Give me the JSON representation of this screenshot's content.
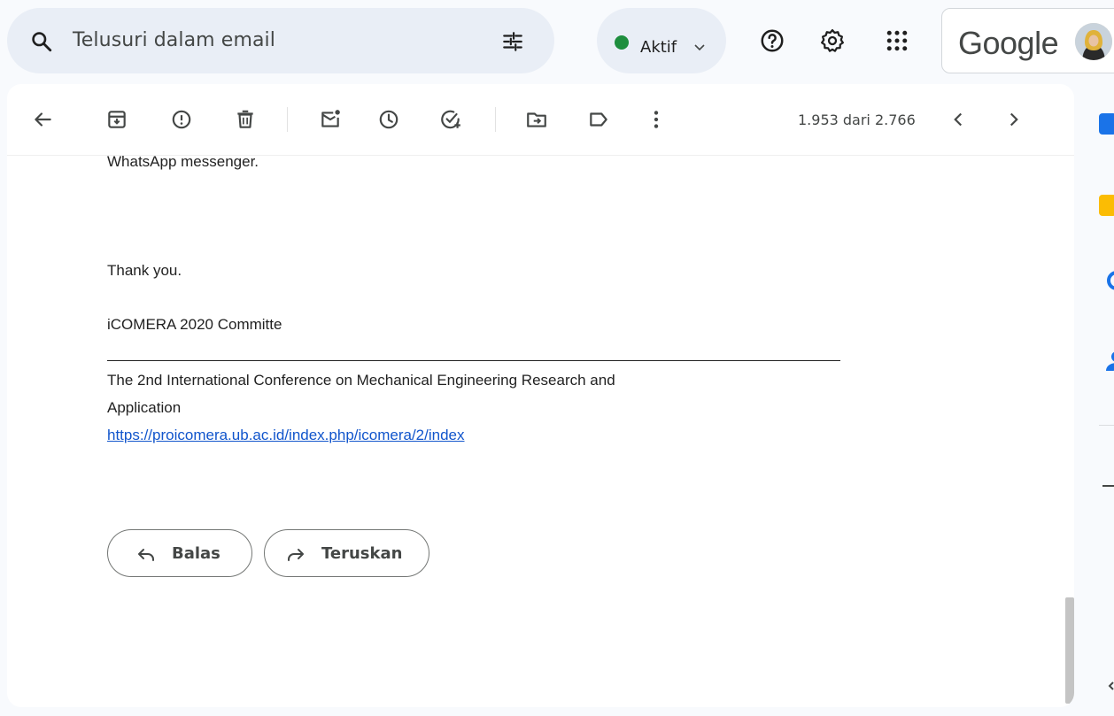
{
  "search": {
    "placeholder": "Telusuri dalam email",
    "icon": "search-icon",
    "filter_icon": "tune-icon"
  },
  "status": {
    "label": "Aktif",
    "color": "#1e8e3e"
  },
  "topbar_icons": [
    "help-icon",
    "settings-icon",
    "apps-icon"
  ],
  "account": {
    "brand": "Google"
  },
  "toolbar": {
    "icons": [
      "back-arrow-icon",
      "archive-icon",
      "report-spam-icon",
      "delete-icon",
      "mark-unread-icon",
      "snooze-icon",
      "add-task-icon",
      "move-to-icon",
      "label-icon",
      "more-icon"
    ],
    "pager": "1.953 dari 2.766"
  },
  "email": {
    "line_whatsapp": "WhatsApp messenger.",
    "thanks": "Thank you.",
    "committee": "iCOMERA 2020 Committe",
    "conference_line1": "The 2nd International Conference on Mechanical Engineering Research and",
    "conference_line2": "Application",
    "url": "https://proicomera.ub.ac.id/index.php/icomera/2/index"
  },
  "actions": {
    "reply": "Balas",
    "forward": "Teruskan"
  },
  "colors": {
    "link": "#1155cc",
    "background": "#f8fafd",
    "search_bg": "#e9eef6"
  }
}
